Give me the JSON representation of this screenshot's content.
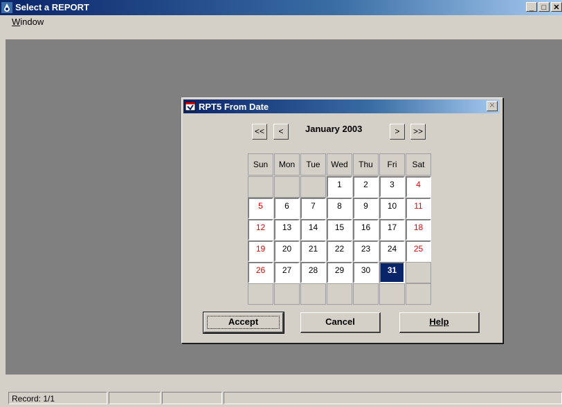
{
  "window": {
    "title": "Select a REPORT",
    "minimize": "_",
    "maximize": "□",
    "close": "✕"
  },
  "menu": {
    "window_label": "Window",
    "window_mnemonic": "W",
    "window_rest": "indow"
  },
  "dialog": {
    "title": "RPT5 From Date",
    "close": "✕",
    "nav": {
      "prev_year": "<<",
      "prev_month": "<",
      "next_month": ">",
      "next_year": ">>"
    },
    "month_label": "January 2003",
    "weekdays": [
      "Sun",
      "Mon",
      "Tue",
      "Wed",
      "Thu",
      "Fri",
      "Sat"
    ],
    "weeks": [
      [
        "",
        "",
        "",
        "1",
        "2",
        "3",
        "4"
      ],
      [
        "5",
        "6",
        "7",
        "8",
        "9",
        "10",
        "11"
      ],
      [
        "12",
        "13",
        "14",
        "15",
        "16",
        "17",
        "18"
      ],
      [
        "19",
        "20",
        "21",
        "22",
        "23",
        "24",
        "25"
      ],
      [
        "26",
        "27",
        "28",
        "29",
        "30",
        "31",
        ""
      ],
      [
        "",
        "",
        "",
        "",
        "",
        "",
        ""
      ]
    ],
    "selected_day": "31",
    "buttons": {
      "accept": "Accept",
      "cancel": "Cancel",
      "help": "Help"
    }
  },
  "status": {
    "record": "Record: 1/1"
  },
  "colors": {
    "title_start": "#0a246a",
    "title_end": "#a6caf0",
    "weekend": "#e00000",
    "selected": "#0a246a",
    "workspace": "#808080"
  }
}
